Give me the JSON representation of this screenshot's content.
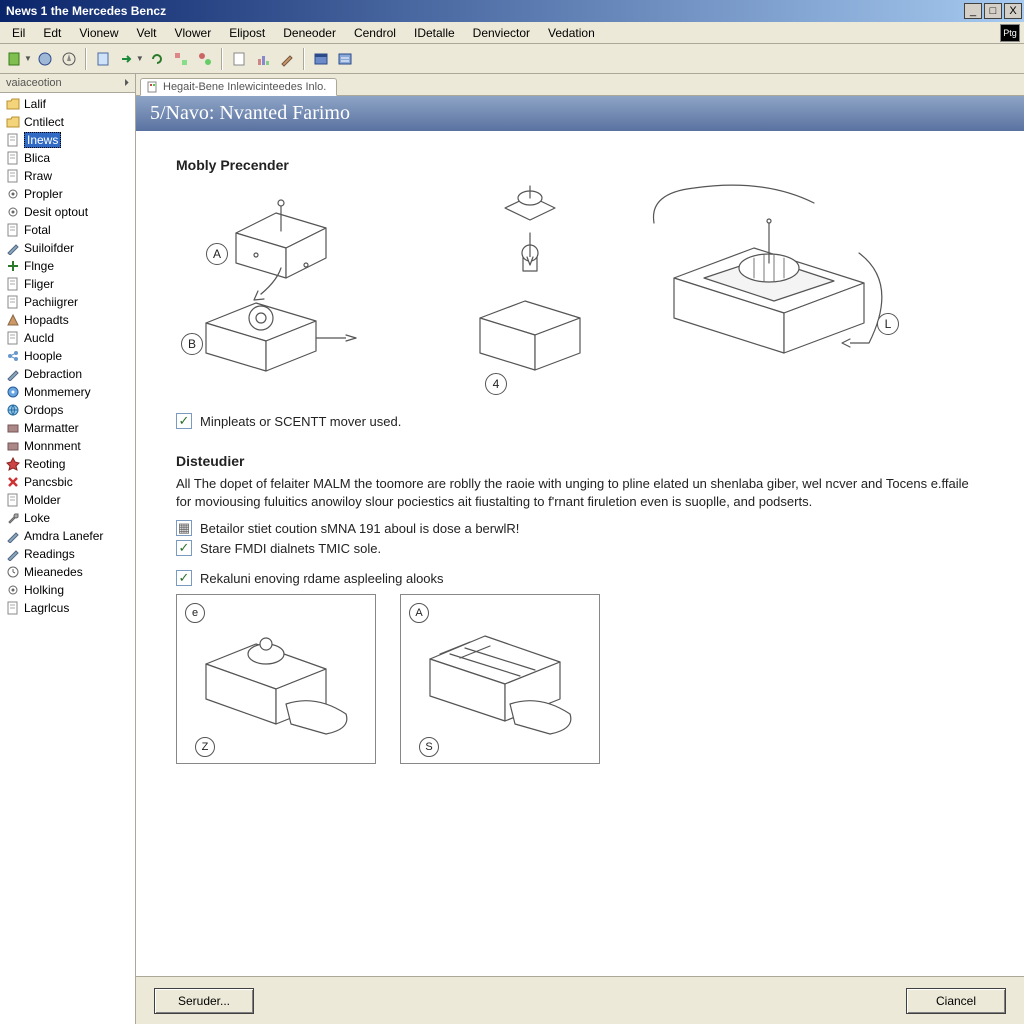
{
  "window": {
    "title": "News 1 the Mercedes Bencz",
    "controls": {
      "min": "_",
      "max": "□",
      "close": "X"
    }
  },
  "menubar": {
    "items": [
      "Eil",
      "Edt",
      "Vionew",
      "Velt",
      "Vlower",
      "Elipost",
      "Deneoder",
      "Cendrol",
      "IDetalle",
      "Denviector",
      "Vedation"
    ],
    "right_tag": "Ptg"
  },
  "sidebar": {
    "header": "vaiaceotion",
    "items": [
      {
        "label": "Lalif",
        "icon": "folder",
        "sel": false
      },
      {
        "label": "Cntilect",
        "icon": "folder",
        "sel": false
      },
      {
        "label": "Inews",
        "icon": "doc",
        "sel": true
      },
      {
        "label": "Blica",
        "icon": "doc",
        "sel": false
      },
      {
        "label": "Rraw",
        "icon": "doc",
        "sel": false
      },
      {
        "label": "Propler",
        "icon": "gear",
        "sel": false
      },
      {
        "label": "Desit optout",
        "icon": "gear",
        "sel": false
      },
      {
        "label": "Fotal",
        "icon": "doc",
        "sel": false
      },
      {
        "label": "Suiloifder",
        "icon": "pen",
        "sel": false
      },
      {
        "label": "Flnge",
        "icon": "plus",
        "sel": false
      },
      {
        "label": "Fliger",
        "icon": "doc",
        "sel": false
      },
      {
        "label": "Pachiigrer",
        "icon": "doc",
        "sel": false
      },
      {
        "label": "Hopadts",
        "icon": "tri",
        "sel": false
      },
      {
        "label": "Aucld",
        "icon": "doc",
        "sel": false
      },
      {
        "label": "Hoople",
        "icon": "node",
        "sel": false
      },
      {
        "label": "Debraction",
        "icon": "pen",
        "sel": false
      },
      {
        "label": "Monmemery",
        "icon": "disc",
        "sel": false
      },
      {
        "label": "Ordops",
        "icon": "globe",
        "sel": false
      },
      {
        "label": "Marmatter",
        "icon": "block",
        "sel": false
      },
      {
        "label": "Monnment",
        "icon": "block",
        "sel": false
      },
      {
        "label": "Reoting",
        "icon": "star",
        "sel": false
      },
      {
        "label": "Pancsbic",
        "icon": "x",
        "sel": false
      },
      {
        "label": "Molder",
        "icon": "doc",
        "sel": false
      },
      {
        "label": "Loke",
        "icon": "wrench",
        "sel": false
      },
      {
        "label": "Amdra Lanefer",
        "icon": "pen",
        "sel": false
      },
      {
        "label": "Readings",
        "icon": "pen",
        "sel": false
      },
      {
        "label": "Mieanedes",
        "icon": "clock",
        "sel": false
      },
      {
        "label": "Holking",
        "icon": "gear",
        "sel": false
      },
      {
        "label": "Lagrlcus",
        "icon": "doc",
        "sel": false
      }
    ]
  },
  "tab": {
    "label": "Hegait-Bene Inlewicinteedes Inlo."
  },
  "doc": {
    "title": "5/Navo: Nvanted Farimo",
    "section1": "Mobly Precender",
    "diagram_labels": {
      "A": "A",
      "B": "B",
      "four": "4",
      "L": "L"
    },
    "check1": "Minpleats or SCENTT mover used.",
    "section2": "Disteudier",
    "para": "All The dopet of felaiter MALM the toomore are roblly the raoie with unging to pline elated un shenlaba giber, wel ncver and Tocens e.ffaile for moviousing fuluitics anowiloy slour pociestics ait fiustalting to f'rnant firuletion even is suoplle, and podserts.",
    "check2a": "Betailor stiet coution sMNA 191 aboul is dose a berwlR!",
    "check2b": "Stare FMDI dialnets TMIC sole.",
    "check3": "Rekaluni enoving rdame aspleeling alooks",
    "diag2_labels": {
      "e": "e",
      "Z": "Z",
      "A": "A",
      "S": "S"
    }
  },
  "buttons": {
    "left": "Seruder...",
    "right": "Ciancel"
  }
}
